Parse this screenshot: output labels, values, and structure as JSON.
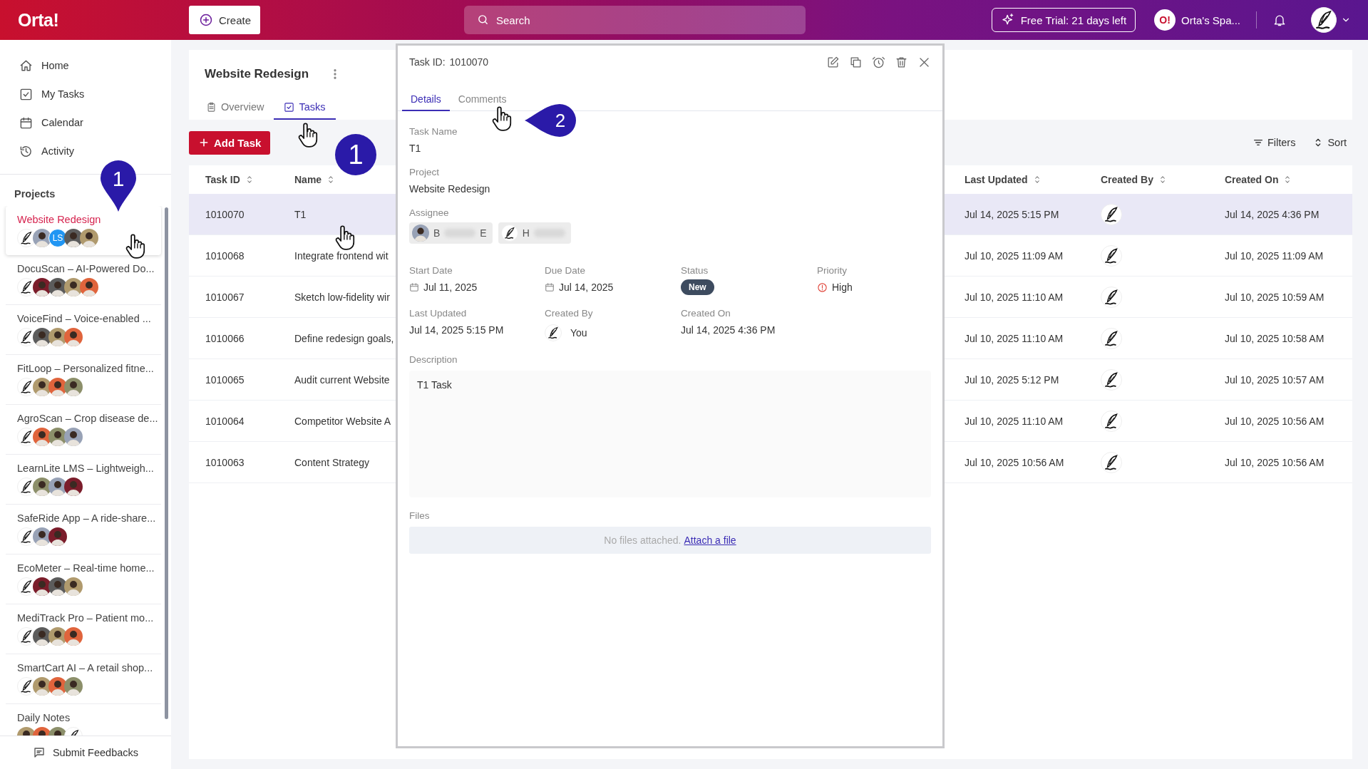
{
  "topbar": {
    "logo": "Orta!",
    "create_button": "Create",
    "search": {
      "placeholder": "Search"
    },
    "trial_button": "Free Trial: 21 days left",
    "workspace": {
      "logo": "O!",
      "name": "Orta's Spa..."
    }
  },
  "sidebar": {
    "nav": [
      {
        "label": "Home"
      },
      {
        "label": "My Tasks"
      },
      {
        "label": "Calendar"
      },
      {
        "label": "Activity"
      }
    ],
    "projects_heading": "Projects",
    "projects": [
      {
        "name": "Website Redesign",
        "selected": true,
        "avatars": [
          {
            "kind": "quill"
          },
          {
            "kind": "photo"
          },
          {
            "kind": "initials",
            "text": "LS"
          },
          {
            "kind": "photo"
          },
          {
            "kind": "photo"
          }
        ]
      },
      {
        "name": "DocuScan – AI-Powered Do...",
        "selected": false,
        "avatars": [
          {
            "kind": "quill"
          },
          {
            "kind": "photo"
          },
          {
            "kind": "photo"
          },
          {
            "kind": "photo"
          },
          {
            "kind": "photo"
          }
        ]
      },
      {
        "name": "VoiceFind – Voice-enabled ...",
        "selected": false,
        "avatars": [
          {
            "kind": "quill"
          },
          {
            "kind": "photo"
          },
          {
            "kind": "photo"
          },
          {
            "kind": "photo"
          }
        ]
      },
      {
        "name": "FitLoop – Personalized fitne...",
        "selected": false,
        "avatars": [
          {
            "kind": "quill"
          },
          {
            "kind": "photo"
          },
          {
            "kind": "photo"
          },
          {
            "kind": "photo"
          }
        ]
      },
      {
        "name": "AgroScan – Crop disease de...",
        "selected": false,
        "avatars": [
          {
            "kind": "quill"
          },
          {
            "kind": "photo"
          },
          {
            "kind": "photo"
          },
          {
            "kind": "photo"
          }
        ]
      },
      {
        "name": "LearnLite LMS – Lightweigh...",
        "selected": false,
        "avatars": [
          {
            "kind": "quill"
          },
          {
            "kind": "photo"
          },
          {
            "kind": "photo"
          },
          {
            "kind": "photo"
          }
        ]
      },
      {
        "name": "SafeRide App – A ride-share...",
        "selected": false,
        "avatars": [
          {
            "kind": "quill"
          },
          {
            "kind": "photo"
          },
          {
            "kind": "photo"
          }
        ]
      },
      {
        "name": "EcoMeter – Real-time home...",
        "selected": false,
        "avatars": [
          {
            "kind": "quill"
          },
          {
            "kind": "photo"
          },
          {
            "kind": "photo"
          },
          {
            "kind": "photo"
          }
        ]
      },
      {
        "name": "MediTrack Pro – Patient mo...",
        "selected": false,
        "avatars": [
          {
            "kind": "quill"
          },
          {
            "kind": "photo"
          },
          {
            "kind": "photo"
          },
          {
            "kind": "photo"
          }
        ]
      },
      {
        "name": "SmartCart AI – A retail shop...",
        "selected": false,
        "avatars": [
          {
            "kind": "quill"
          },
          {
            "kind": "photo"
          },
          {
            "kind": "photo"
          },
          {
            "kind": "photo"
          }
        ]
      },
      {
        "name": "Daily Notes",
        "selected": false,
        "avatars": [
          {
            "kind": "photo"
          },
          {
            "kind": "photo"
          },
          {
            "kind": "photo"
          },
          {
            "kind": "quill"
          }
        ]
      }
    ],
    "feedback_button": "Submit Feedbacks"
  },
  "project": {
    "title": "Website Redesign",
    "tabs": [
      {
        "label": "Overview",
        "selected": false
      },
      {
        "label": "Tasks",
        "selected": true
      }
    ],
    "add_task_button": "Add Task",
    "filters_button": "Filters",
    "sort_button": "Sort"
  },
  "table": {
    "columns": [
      {
        "label": "Task ID"
      },
      {
        "label": "Name"
      },
      {
        "label": "Last Updated"
      },
      {
        "label": "Created By"
      },
      {
        "label": "Created On"
      }
    ],
    "rows": [
      {
        "task_id": "1010070",
        "name": "T1",
        "last_updated": "Jul 14, 2025 5:15 PM",
        "created_by": {
          "kind": "quill"
        },
        "created_on": "Jul 14, 2025 4:36 PM",
        "selected": true
      },
      {
        "task_id": "1010068",
        "name": "Integrate frontend wit",
        "last_updated": "Jul 10, 2025 11:09 AM",
        "created_by": {
          "kind": "quill"
        },
        "created_on": "Jul 10, 2025 11:09 AM",
        "selected": false
      },
      {
        "task_id": "1010067",
        "name": "Sketch low-fidelity wir",
        "last_updated": "Jul 10, 2025 11:10 AM",
        "created_by": {
          "kind": "quill"
        },
        "created_on": "Jul 10, 2025 10:59 AM",
        "selected": false
      },
      {
        "task_id": "1010066",
        "name": "Define redesign goals,",
        "last_updated": "Jul 10, 2025 11:10 AM",
        "created_by": {
          "kind": "quill"
        },
        "created_on": "Jul 10, 2025 10:58 AM",
        "selected": false
      },
      {
        "task_id": "1010065",
        "name": "Audit current Website",
        "last_updated": "Jul 10, 2025 5:12 PM",
        "created_by": {
          "kind": "quill"
        },
        "created_on": "Jul 10, 2025 10:57 AM",
        "selected": false
      },
      {
        "task_id": "1010064",
        "name": "Competitor Website A",
        "last_updated": "Jul 10, 2025 11:10 AM",
        "created_by": {
          "kind": "quill"
        },
        "created_on": "Jul 10, 2025 10:56 AM",
        "selected": false
      },
      {
        "task_id": "1010063",
        "name": "Content Strategy",
        "last_updated": "Jul 10, 2025 10:56 AM",
        "created_by": {
          "kind": "quill"
        },
        "created_on": "Jul 10, 2025 10:56 AM",
        "selected": false
      }
    ]
  },
  "task_panel": {
    "task_id_label": "Task ID:",
    "task_id": "1010070",
    "tabs": [
      {
        "label": "Details",
        "selected": true
      },
      {
        "label": "Comments",
        "selected": false
      }
    ],
    "task_name": {
      "label": "Task Name",
      "value": "T1"
    },
    "project": {
      "label": "Project",
      "value": "Website Redesign"
    },
    "assignee": {
      "label": "Assignee",
      "chips": [
        {
          "avatar": {
            "kind": "photo"
          },
          "name_start": "B",
          "name_end": "E"
        },
        {
          "avatar": {
            "kind": "quill"
          },
          "name_start": "H"
        }
      ]
    },
    "start_date": {
      "label": "Start Date",
      "value": "Jul 11, 2025"
    },
    "due_date": {
      "label": "Due Date",
      "value": "Jul 14, 2025"
    },
    "status": {
      "label": "Status",
      "value": "New"
    },
    "priority": {
      "label": "Priority",
      "value": "High"
    },
    "last_updated": {
      "label": "Last Updated",
      "value": "Jul 14, 2025 5:15 PM"
    },
    "created_by": {
      "label": "Created By",
      "avatar": {
        "kind": "quill"
      },
      "value": "You"
    },
    "created_on": {
      "label": "Created On",
      "value": "Jul 14, 2025 4:36 PM"
    },
    "description": {
      "label": "Description",
      "value": "T1 Task"
    },
    "files": {
      "label": "Files",
      "empty_text": "No files attached.",
      "link": "Attach a file"
    }
  },
  "annotations": [
    {
      "kind": "pin",
      "label": "1"
    },
    {
      "kind": "circle",
      "label": "1"
    },
    {
      "kind": "callout",
      "label": "2"
    }
  ]
}
